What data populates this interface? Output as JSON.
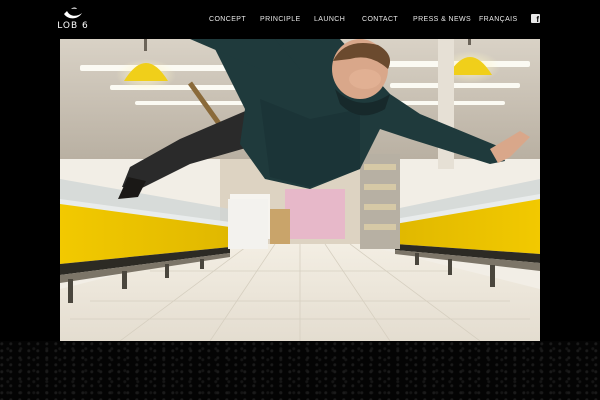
{
  "brand": {
    "logo_text": "LOB 6",
    "logo_icon": "wave-swoosh-icon"
  },
  "nav": {
    "items": [
      {
        "label": "CONCEPT"
      },
      {
        "label": "PRINCIPLE"
      },
      {
        "label": "LAUNCH"
      },
      {
        "label": "CONTACT"
      },
      {
        "label": "PRESS & NEWS"
      },
      {
        "label": "FRANÇAIS"
      }
    ],
    "social_icon": "facebook-icon"
  },
  "hero": {
    "subject": "man-floating-in-supermarket-aisle",
    "colors": {
      "background": "#000000",
      "shelf_yellow": "#e8c400",
      "floor": "#ebe6d8",
      "sweater": "#1f3a3c"
    }
  }
}
